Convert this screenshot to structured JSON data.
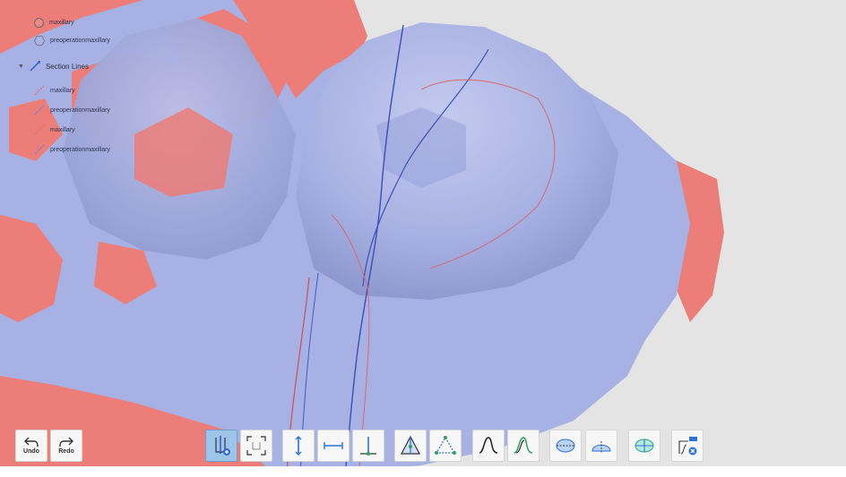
{
  "legend": {
    "models": [
      {
        "label": "maxillary",
        "color": "#f08a86",
        "icon": "circle-icon"
      },
      {
        "label": "preoperationmaxillary",
        "color": "#aab3e6",
        "icon": "hexagon-icon"
      }
    ],
    "section_lines": {
      "title": "Section Lines",
      "items": [
        {
          "label": "maxillary",
          "color": "#e06e6e"
        },
        {
          "label": "preoperationmaxillary",
          "color": "#6d80d8"
        },
        {
          "label": "maxillary",
          "color": "#e06e6e"
        },
        {
          "label": "preoperationmaxillary",
          "color": "#6d80d8"
        }
      ]
    }
  },
  "toolbar": {
    "undo_label": "Undo",
    "redo_label": "Redo"
  },
  "colors": {
    "model_red": "#ec7d78",
    "model_blue": "#aab3e6",
    "accent": "#9ec4ea"
  }
}
